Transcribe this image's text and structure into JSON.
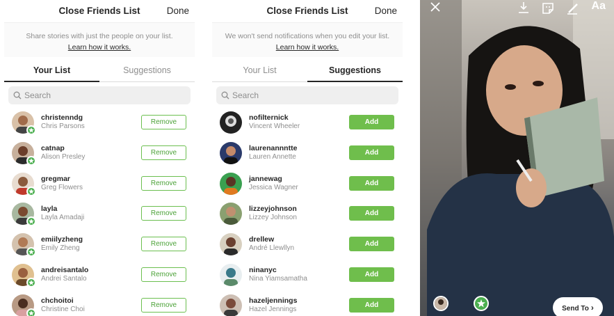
{
  "left_screen": {
    "header": {
      "title": "Close Friends List",
      "done": "Done"
    },
    "description": {
      "text": "Share stories with just the people on your list.",
      "link": "Learn how it works."
    },
    "tabs": [
      {
        "label": "Your List",
        "active": true
      },
      {
        "label": "Suggestions",
        "active": false
      }
    ],
    "search": {
      "placeholder": "Search"
    },
    "rows": [
      {
        "username": "christenndg",
        "name": "Chris Parsons",
        "action": "Remove"
      },
      {
        "username": "catnap",
        "name": "Alison Presley",
        "action": "Remove"
      },
      {
        "username": "gregmar",
        "name": "Greg Flowers",
        "action": "Remove"
      },
      {
        "username": "layla",
        "name": "Layla Amadaji",
        "action": "Remove"
      },
      {
        "username": "emiilyzheng",
        "name": "Emily Zheng",
        "action": "Remove"
      },
      {
        "username": "andreisantalo",
        "name": "Andrei Santalo",
        "action": "Remove"
      },
      {
        "username": "chchoitoi",
        "name": "Christine Choi",
        "action": "Remove"
      }
    ]
  },
  "middle_screen": {
    "header": {
      "title": "Close Friends List",
      "done": "Done"
    },
    "description": {
      "text": "We won't send notifications when you edit your list.",
      "link": "Learn how it works."
    },
    "tabs": [
      {
        "label": "Your List",
        "active": false
      },
      {
        "label": "Suggestions",
        "active": true
      }
    ],
    "search": {
      "placeholder": "Search"
    },
    "rows": [
      {
        "username": "nofilternick",
        "name": "Vincent Wheeler",
        "action": "Add"
      },
      {
        "username": "laurenannntte",
        "name": "Lauren Annette",
        "action": "Add"
      },
      {
        "username": "jannewag",
        "name": "Jessica Wagner",
        "action": "Add"
      },
      {
        "username": "lizzeyjohnson",
        "name": "Lizzey Johnson",
        "action": "Add"
      },
      {
        "username": "drellew",
        "name": "André Llewllyn",
        "action": "Add"
      },
      {
        "username": "ninanyc",
        "name": "Nina Yiamsamatha",
        "action": "Add"
      },
      {
        "username": "hazeljennings",
        "name": "Hazel Jennings",
        "action": "Add"
      }
    ]
  },
  "story_screen": {
    "top_icons": [
      "close-icon",
      "download-icon",
      "sticker-icon",
      "draw-icon"
    ],
    "text_tool": "Aa",
    "send_to": "Send To",
    "bottom_icons": [
      "your-story-avatar",
      "close-friends-star-icon"
    ]
  },
  "colors": {
    "accent_green": "#6fbe4c",
    "badge_green": "#4caf50",
    "text_primary": "#262626",
    "text_secondary": "#8e8e8e"
  }
}
